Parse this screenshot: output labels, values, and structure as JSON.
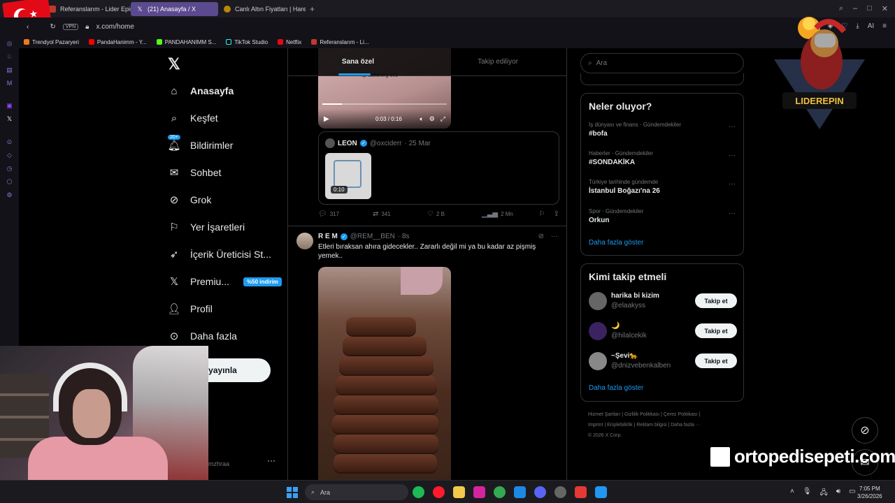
{
  "browser": {
    "tabs": [
      {
        "label": "Referanslarım - Lider Epin",
        "active": false
      },
      {
        "label": "(21) Anasayfa / X",
        "active": true
      },
      {
        "label": "Canlı Altın Fiyatları | Haren",
        "active": false
      }
    ],
    "vpn": "VPN",
    "url": "x.com/home",
    "ai_label": "AI",
    "bookmarks": [
      "Trendyol Pazaryeri",
      "PandaHanimm - Y...",
      "PANDAHANIMM S...",
      "TikTok Studio",
      "Netflix",
      "Referanslarım - Li..."
    ]
  },
  "nav": {
    "items": [
      {
        "label": "Anasayfa",
        "icon": "home-icon"
      },
      {
        "label": "Keşfet",
        "icon": "search-icon"
      },
      {
        "label": "Bildirimler",
        "icon": "bell-icon",
        "badge": "20+"
      },
      {
        "label": "Sohbet",
        "icon": "mail-icon"
      },
      {
        "label": "Grok",
        "icon": "grok-icon"
      },
      {
        "label": "Yer İşaretleri",
        "icon": "bookmark-icon"
      },
      {
        "label": "İçerik Üreticisi St...",
        "icon": "rocket-icon"
      },
      {
        "label": "Premiu...",
        "icon": "x-logo-icon",
        "promo": "%50 indirim"
      },
      {
        "label": "Profil",
        "icon": "person-icon"
      },
      {
        "label": "Daha fazla",
        "icon": "more-circle-icon"
      }
    ],
    "post_button": "eri yayınla",
    "account_handle": "mzhraa"
  },
  "feed": {
    "tabs": [
      "Sana özel",
      "Takip ediliyor"
    ],
    "video1": {
      "caption": "lip catfishing 101",
      "time": "0:03 / 0:16"
    },
    "quote": {
      "name": "LEON",
      "handle": "@oxciderr",
      "date": "· 25 Mar",
      "duration": "0:10"
    },
    "actions": {
      "replies": "317",
      "reposts": "341",
      "likes": "2 B",
      "views": "2 Mn"
    },
    "post2": {
      "name": "R E M",
      "handle": "@REM__BEN",
      "time": "· 8s",
      "text": "Etleri bıraksan ahıra gidecekler.. Zararlı değil mi ya bu kadar az pişmiş yemek.."
    }
  },
  "sidebar": {
    "search_placeholder": "Ara",
    "trends_title": "Neler oluyor?",
    "trends": [
      {
        "category": "İş dünyası ve finans · Gündemdekiler",
        "topic": "#bofa"
      },
      {
        "category": "Haberler · Gündemdekiler",
        "topic": "#SONDAKİKA"
      },
      {
        "category": "Türkiye tarihinde gündemde",
        "topic": "İstanbul Boğazı'na 26"
      },
      {
        "category": "Spor · Gündemdekiler",
        "topic": "Orkun"
      }
    ],
    "show_more": "Daha fazla göster",
    "who_title": "Kimi takip etmeli",
    "who": [
      {
        "name": "harika bi kizim",
        "handle": "@elaakyss"
      },
      {
        "name": "🌙",
        "handle": "@hilalcekik"
      },
      {
        "name": "~Şevi🐆",
        "handle": "@dnizvebenkalben"
      }
    ],
    "follow_label": "Takip et",
    "footer_line1": "Hizmet Şartları | Gizlilik Politikası | Çerez Politikası |",
    "footer_line2": "Imprint | Erişilebilirlik | Reklam bilgisi | Daha fazla ···",
    "footer_line3": "© 2026 X Corp."
  },
  "overlay": {
    "mascot_text": "LIDEREPIN",
    "ad_text": "ortopedisepeti.com"
  },
  "taskbar": {
    "search": "Ara",
    "time": "7:05 PM",
    "date": "3/26/2026"
  },
  "colors": {
    "accent": "#1d9bf0",
    "background": "#000000",
    "text": "#e7e9ea",
    "muted": "#71767b",
    "border": "#2f3336"
  }
}
